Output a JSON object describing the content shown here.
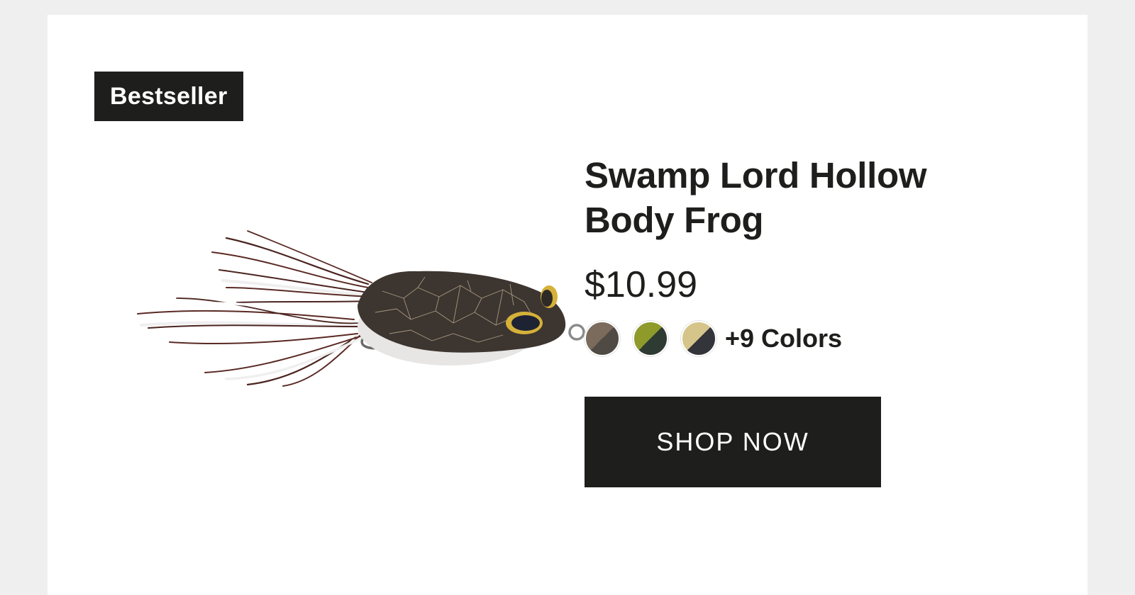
{
  "badge": {
    "label": "Bestseller"
  },
  "product": {
    "title_line1": "Swamp Lord Hollow",
    "title_line2": "Body Frog",
    "price": "$10.99",
    "image_icon": "frog-lure-image"
  },
  "swatches": [
    {
      "name": "swatch-1",
      "color_a": "#7a6b5c",
      "color_b": "#4f4a44"
    },
    {
      "name": "swatch-2",
      "color_a": "#8e9a2a",
      "color_b": "#2e3b33"
    },
    {
      "name": "swatch-3",
      "color_a": "#d6c58a",
      "color_b": "#34343b"
    }
  ],
  "more_colors": "+9 Colors",
  "cta": {
    "label": "SHOP NOW"
  },
  "colors": {
    "dark": "#1e1e1c",
    "page_bg": "#efefef",
    "card_bg": "#ffffff"
  }
}
